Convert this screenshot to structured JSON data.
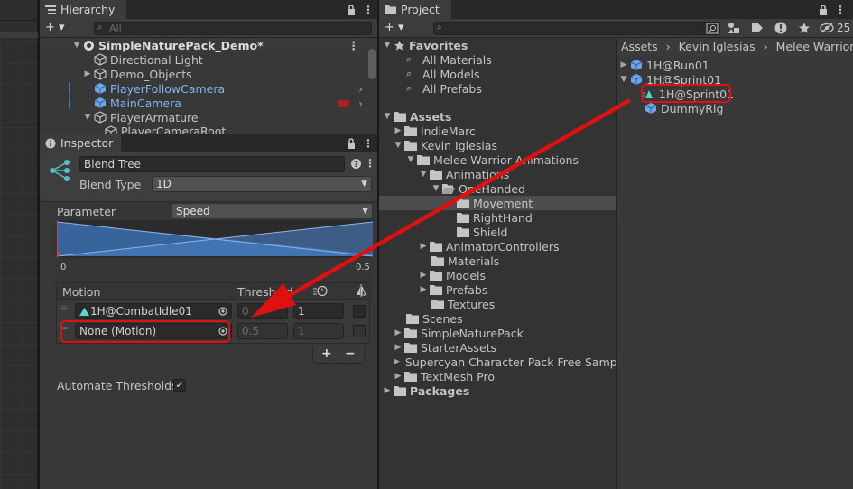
{
  "hierarchy": {
    "tab_title": "Hierarchy",
    "add_label": "+ ▾",
    "search_placeholder": "All",
    "scene_name": "SimpleNaturePack_Demo*",
    "items": [
      {
        "label": "Directional Light"
      },
      {
        "label": "Demo_Objects"
      },
      {
        "label": "PlayerFollowCamera"
      },
      {
        "label": "MainCamera"
      },
      {
        "label": "PlayerArmature"
      },
      {
        "label": "PlayerCameraRoot"
      }
    ]
  },
  "inspector": {
    "tab_title": "Inspector",
    "object_name": "Blend Tree",
    "blend_type_label": "Blend Type",
    "blend_type_value": "1D",
    "parameter_label": "Parameter",
    "parameter_value": "Speed",
    "graph_min": "0",
    "graph_max": "0.5",
    "motion_header": "Motion",
    "threshold_header": "Threshold",
    "motions": [
      {
        "name": "1H@CombatIdle01",
        "threshold": "0",
        "speed": "1"
      },
      {
        "name": "None (Motion)",
        "threshold": "0.5",
        "speed": "1"
      }
    ],
    "add_button": "+",
    "remove_button": "−",
    "automate_label": "Automate Thresholds",
    "automate_checked": "✓"
  },
  "project": {
    "tab_title": "Project",
    "add_label": "+ ▾",
    "hidden_count": "25",
    "favorites": {
      "label": "Favorites",
      "items": [
        "All Materials",
        "All Models",
        "All Prefabs"
      ]
    },
    "tree": [
      {
        "label": "Assets"
      },
      {
        "label": "IndieMarc"
      },
      {
        "label": "Kevin Iglesias"
      },
      {
        "label": "Melee Warrior Animations"
      },
      {
        "label": "Animations"
      },
      {
        "label": "OneHanded"
      },
      {
        "label": "Movement"
      },
      {
        "label": "RightHand"
      },
      {
        "label": "Shield"
      },
      {
        "label": "AnimatorControllers"
      },
      {
        "label": "Materials"
      },
      {
        "label": "Models"
      },
      {
        "label": "Prefabs"
      },
      {
        "label": "Textures"
      },
      {
        "label": "Scenes"
      },
      {
        "label": "SimpleNaturePack"
      },
      {
        "label": "StarterAssets"
      },
      {
        "label": "Supercyan Character Pack Free Samp"
      },
      {
        "label": "TextMesh Pro"
      },
      {
        "label": "Packages"
      }
    ],
    "breadcrumb": [
      "Assets",
      "Kevin Iglesias",
      "Melee Warrior Anim"
    ],
    "files": [
      {
        "label": "1H@Run01"
      },
      {
        "label": "1H@Sprint01"
      },
      {
        "label": "1H@Sprint01"
      },
      {
        "label": "DummyRig"
      }
    ]
  },
  "colors": {
    "accent_blue": "#3d74c9",
    "annotation_red": "#e01010",
    "selection": "#4d4d4d"
  }
}
